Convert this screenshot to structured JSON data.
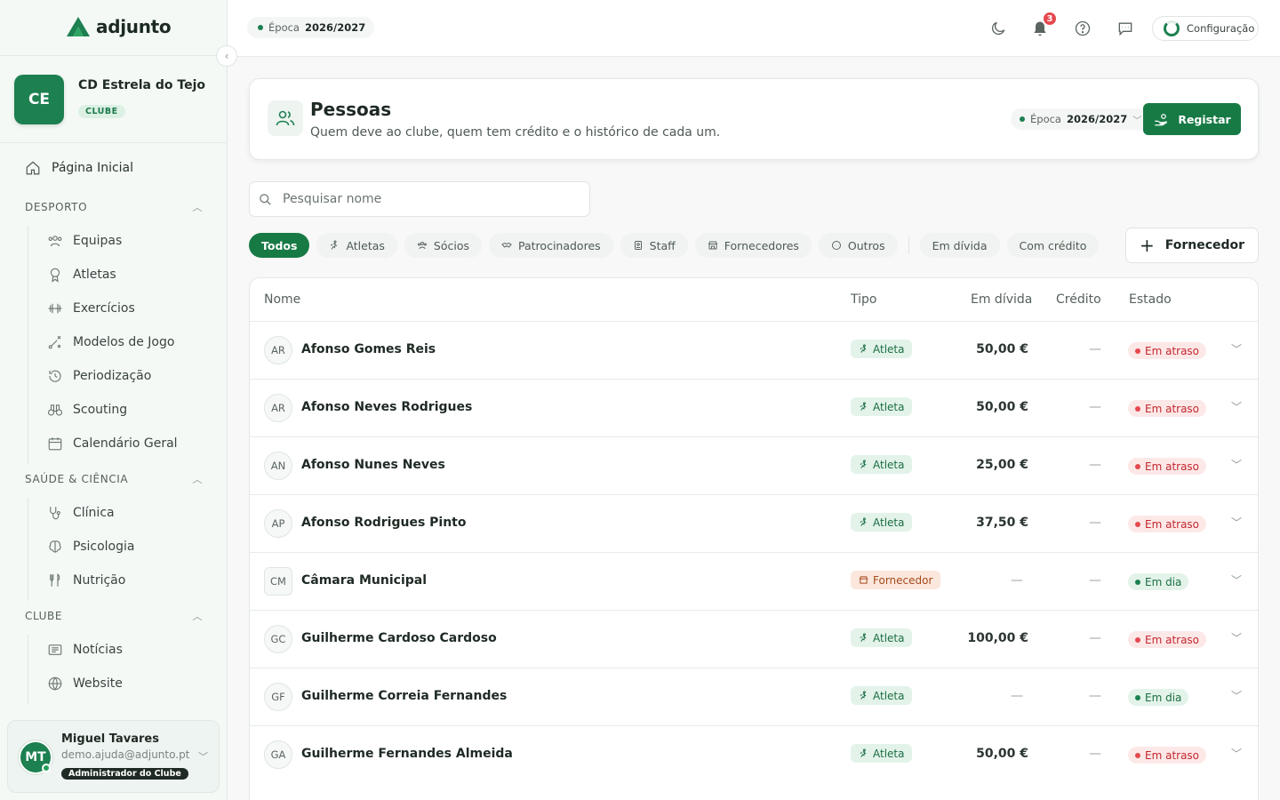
{
  "brand": {
    "name": "adjunto"
  },
  "club": {
    "initials": "CE",
    "name": "CD Estrela do Tejo",
    "badge": "CLUBE"
  },
  "nav": {
    "home": "Página Inicial",
    "sections": [
      {
        "title": "DESPORTO",
        "items": [
          "Equipas",
          "Atletas",
          "Exercícios",
          "Modelos de Jogo",
          "Periodização",
          "Scouting",
          "Calendário Geral"
        ]
      },
      {
        "title": "SAÚDE & CIÊNCIA",
        "items": [
          "Clínica",
          "Psicologia",
          "Nutrição"
        ]
      },
      {
        "title": "CLUBE",
        "items": [
          "Notícias",
          "Website"
        ]
      }
    ]
  },
  "user": {
    "initials": "MT",
    "name": "Miguel Tavares",
    "email": "demo.ajuda@adjunto.pt",
    "role": "Administrador do Clube"
  },
  "topbar": {
    "season_label": "Época",
    "season_value": "2026/2027",
    "notifications": "3",
    "config_label": "Configuração",
    "icons": [
      "moon-icon",
      "bell-icon",
      "help-icon",
      "chat-icon"
    ]
  },
  "page": {
    "title": "Pessoas",
    "subtitle": "Quem deve ao clube, quem tem crédito e o histórico de cada um.",
    "season_label": "Época",
    "season_value": "2026/2027",
    "register_label": "Registar"
  },
  "search": {
    "placeholder": "Pesquisar nome",
    "value": ""
  },
  "filters": {
    "todos": "Todos",
    "atletas": "Atletas",
    "socios": "Sócios",
    "patrocinadores": "Patrocinadores",
    "staff": "Staff",
    "fornecedores": "Fornecedores",
    "outros": "Outros",
    "em_divida": "Em dívida",
    "com_credito": "Com crédito",
    "active": "Todos"
  },
  "add_supplier_label": "Fornecedor",
  "table": {
    "columns": {
      "nome": "Nome",
      "tipo": "Tipo",
      "divida": "Em dívida",
      "credito": "Crédito",
      "estado": "Estado"
    },
    "rows": [
      {
        "initials": "AR",
        "name": "Afonso Gomes Reis",
        "type": "Atleta",
        "debt": "50,00 €",
        "credit": "—",
        "status": "Em atraso"
      },
      {
        "initials": "AR",
        "name": "Afonso Neves Rodrigues",
        "type": "Atleta",
        "debt": "50,00 €",
        "credit": "—",
        "status": "Em atraso"
      },
      {
        "initials": "AN",
        "name": "Afonso Nunes Neves",
        "type": "Atleta",
        "debt": "25,00 €",
        "credit": "—",
        "status": "Em atraso"
      },
      {
        "initials": "AP",
        "name": "Afonso Rodrigues Pinto",
        "type": "Atleta",
        "debt": "37,50 €",
        "credit": "—",
        "status": "Em atraso"
      },
      {
        "initials": "CM",
        "name": "Câmara Municipal",
        "type": "Fornecedor",
        "debt": "—",
        "credit": "—",
        "status": "Em dia"
      },
      {
        "initials": "GC",
        "name": "Guilherme Cardoso Cardoso",
        "type": "Atleta",
        "debt": "100,00 €",
        "credit": "—",
        "status": "Em atraso"
      },
      {
        "initials": "GF",
        "name": "Guilherme Correia Fernandes",
        "type": "Atleta",
        "debt": "—",
        "credit": "—",
        "status": "Em dia"
      },
      {
        "initials": "GA",
        "name": "Guilherme Fernandes Almeida",
        "type": "Atleta",
        "debt": "50,00 €",
        "credit": "—",
        "status": "Em atraso"
      }
    ]
  },
  "colors": {
    "brand": "#177a45",
    "danger": "#e5484d",
    "supplier": "#a64a1c"
  }
}
